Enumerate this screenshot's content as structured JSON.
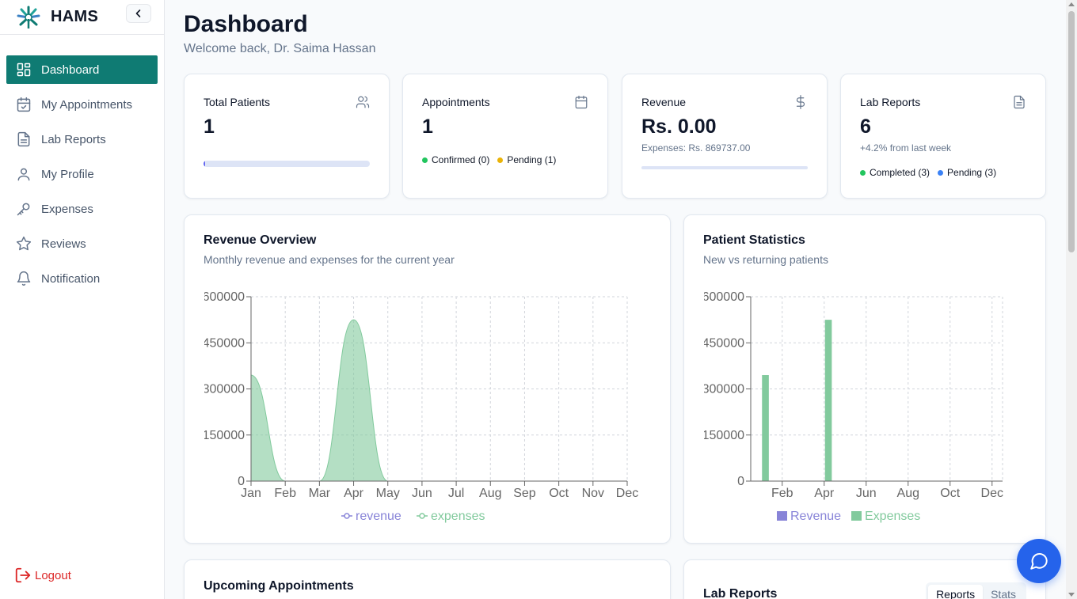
{
  "app": {
    "name": "HAMS"
  },
  "sidebar": {
    "items": [
      {
        "label": "Dashboard",
        "icon": "dashboard-icon",
        "active": true
      },
      {
        "label": "My Appointments",
        "icon": "calendar-check-icon"
      },
      {
        "label": "Lab Reports",
        "icon": "file-text-icon"
      },
      {
        "label": "My Profile",
        "icon": "user-icon"
      },
      {
        "label": "Expenses",
        "icon": "key-icon"
      },
      {
        "label": "Reviews",
        "icon": "star-icon"
      },
      {
        "label": "Notification",
        "icon": "bell-icon"
      }
    ],
    "logout_label": "Logout"
  },
  "header": {
    "title": "Dashboard",
    "subtitle": "Welcome back, Dr. Saima Hassan"
  },
  "stats": {
    "total_patients": {
      "title": "Total Patients",
      "value": "1",
      "progress": 0.01
    },
    "appointments": {
      "title": "Appointments",
      "value": "1",
      "confirmed": "Confirmed (0)",
      "pending": "Pending (1)"
    },
    "revenue": {
      "title": "Revenue",
      "value": "Rs. 0.00",
      "expenses": "Expenses: Rs. 869737.00",
      "progress": 0
    },
    "lab_reports": {
      "title": "Lab Reports",
      "value": "6",
      "change": "+4.2% from last week",
      "completed": "Completed (3)",
      "pending": "Pending (3)"
    }
  },
  "colors": {
    "accent": "#0f7b73",
    "revenue": "#8884d8",
    "expenses": "#82ca9d",
    "confirmed": "#22c55e",
    "pending": "#eab308",
    "completed": "#22c55e",
    "lab_pending": "#3b82f6",
    "logout": "#dc2626",
    "fab": "#2563eb"
  },
  "revenue_overview": {
    "title": "Revenue Overview",
    "subtitle": "Monthly revenue and expenses for the current year"
  },
  "patient_statistics": {
    "title": "Patient Statistics",
    "subtitle": "New vs returning patients"
  },
  "upcoming": {
    "title": "Upcoming Appointments"
  },
  "lab_panel": {
    "title": "Lab Reports",
    "tabs": [
      "Reports",
      "Stats"
    ]
  },
  "chart_data": [
    {
      "type": "area",
      "categories": [
        "Jan",
        "Feb",
        "Mar",
        "Apr",
        "May",
        "Jun",
        "Jul",
        "Aug",
        "Sep",
        "Oct",
        "Nov",
        "Dec"
      ],
      "ytick_labels": [
        "0",
        "150000",
        "300000",
        "450000",
        "600000"
      ],
      "ylim": [
        0,
        600000
      ],
      "grid": true,
      "legend": "bottom",
      "series": [
        {
          "name": "revenue",
          "color": "#8884d8",
          "values": [
            0,
            0,
            0,
            0,
            0,
            0,
            0,
            0,
            0,
            0,
            0,
            0
          ]
        },
        {
          "name": "expenses",
          "color": "#82ca9d",
          "values": [
            345000,
            0,
            0,
            525000,
            0,
            0,
            0,
            0,
            0,
            0,
            0,
            0
          ]
        }
      ]
    },
    {
      "type": "bar",
      "categories": [
        "Jan",
        "Feb",
        "Mar",
        "Apr",
        "May",
        "Jun",
        "Jul",
        "Aug",
        "Sep",
        "Oct",
        "Nov",
        "Dec"
      ],
      "xtick_labels": [
        "Feb",
        "Apr",
        "Jun",
        "Aug",
        "Oct",
        "Dec"
      ],
      "ytick_labels": [
        "0",
        "150000",
        "300000",
        "450000",
        "600000"
      ],
      "ylim": [
        0,
        600000
      ],
      "grid": true,
      "legend": "bottom",
      "series": [
        {
          "name": "Revenue",
          "color": "#8884d8",
          "values": [
            0,
            0,
            0,
            0,
            0,
            0,
            0,
            0,
            0,
            0,
            0,
            0
          ]
        },
        {
          "name": "Expenses",
          "color": "#82ca9d",
          "values": [
            345000,
            0,
            0,
            525000,
            0,
            0,
            0,
            0,
            0,
            0,
            0,
            0
          ]
        }
      ]
    }
  ]
}
